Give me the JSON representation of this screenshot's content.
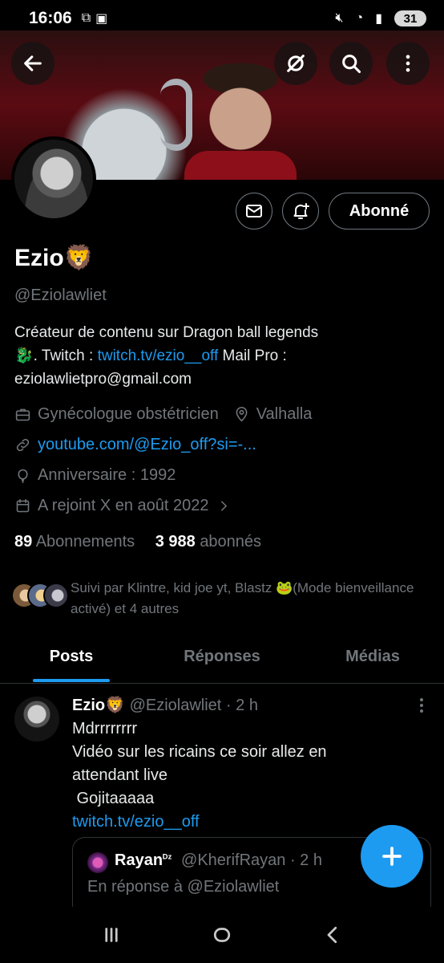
{
  "status_bar": {
    "time": "16:06",
    "battery": "31"
  },
  "profile": {
    "name": "Ezio🦁",
    "handle": "@Eziolawliet",
    "bio_line1": "Créateur de contenu sur Dragon ball legends",
    "bio_emoji": "🐉",
    "bio_twitch_prefix": ".  Twitch : ",
    "bio_twitch_link": "twitch.tv/ezio__off",
    "bio_mail_prefix": "  Mail Pro :",
    "bio_mail": "eziolawlietpro@gmail.com",
    "profession": "Gynécologue obstétricien",
    "location": "Valhalla",
    "website": "youtube.com/@Ezio_off?si=-...",
    "birthday": "Anniversaire : 1992",
    "joined": "A rejoint X en août 2022",
    "following_count": "89",
    "following_label": "Abonnements",
    "followers_count": "3 988",
    "followers_label": "abonnés",
    "followed_by": "Suivi par Klintre, kid joe yt, Blastz 🐸(Mode bienveillance activé) et 4 autres"
  },
  "actions": {
    "follow_label": "Abonné"
  },
  "tabs": [
    {
      "label": "Posts",
      "active": true
    },
    {
      "label": "Réponses",
      "active": false
    },
    {
      "label": "Médias",
      "active": false
    }
  ],
  "post": {
    "author_name": "Ezio🦁",
    "author_handle_time": "@Eziolawliet · 2 h",
    "line1": "Mdrrrrrrrr",
    "line2": "Vidéo sur les ricains ce soir allez en attendant live",
    "line3": " Gojitaaaaa",
    "link": "twitch.tv/ezio__off",
    "quote": {
      "name": "Rayan",
      "name_suffix": "ᴰᶻ",
      "handle_time": "@KherifRayan · 2 h",
      "reply_to": "En réponse à @Eziolawliet"
    }
  },
  "colors": {
    "accent": "#1d9bf0",
    "muted": "#71767b",
    "background": "#000000"
  },
  "icons": [
    "back-arrow-icon",
    "grok-icon",
    "search-icon",
    "more-vertical-icon",
    "mail-icon",
    "bell-plus-icon",
    "briefcase-icon",
    "location-icon",
    "link-icon",
    "balloon-icon",
    "calendar-icon",
    "chevron-right-icon",
    "plus-icon",
    "recents-icon",
    "home-icon",
    "back-icon"
  ]
}
